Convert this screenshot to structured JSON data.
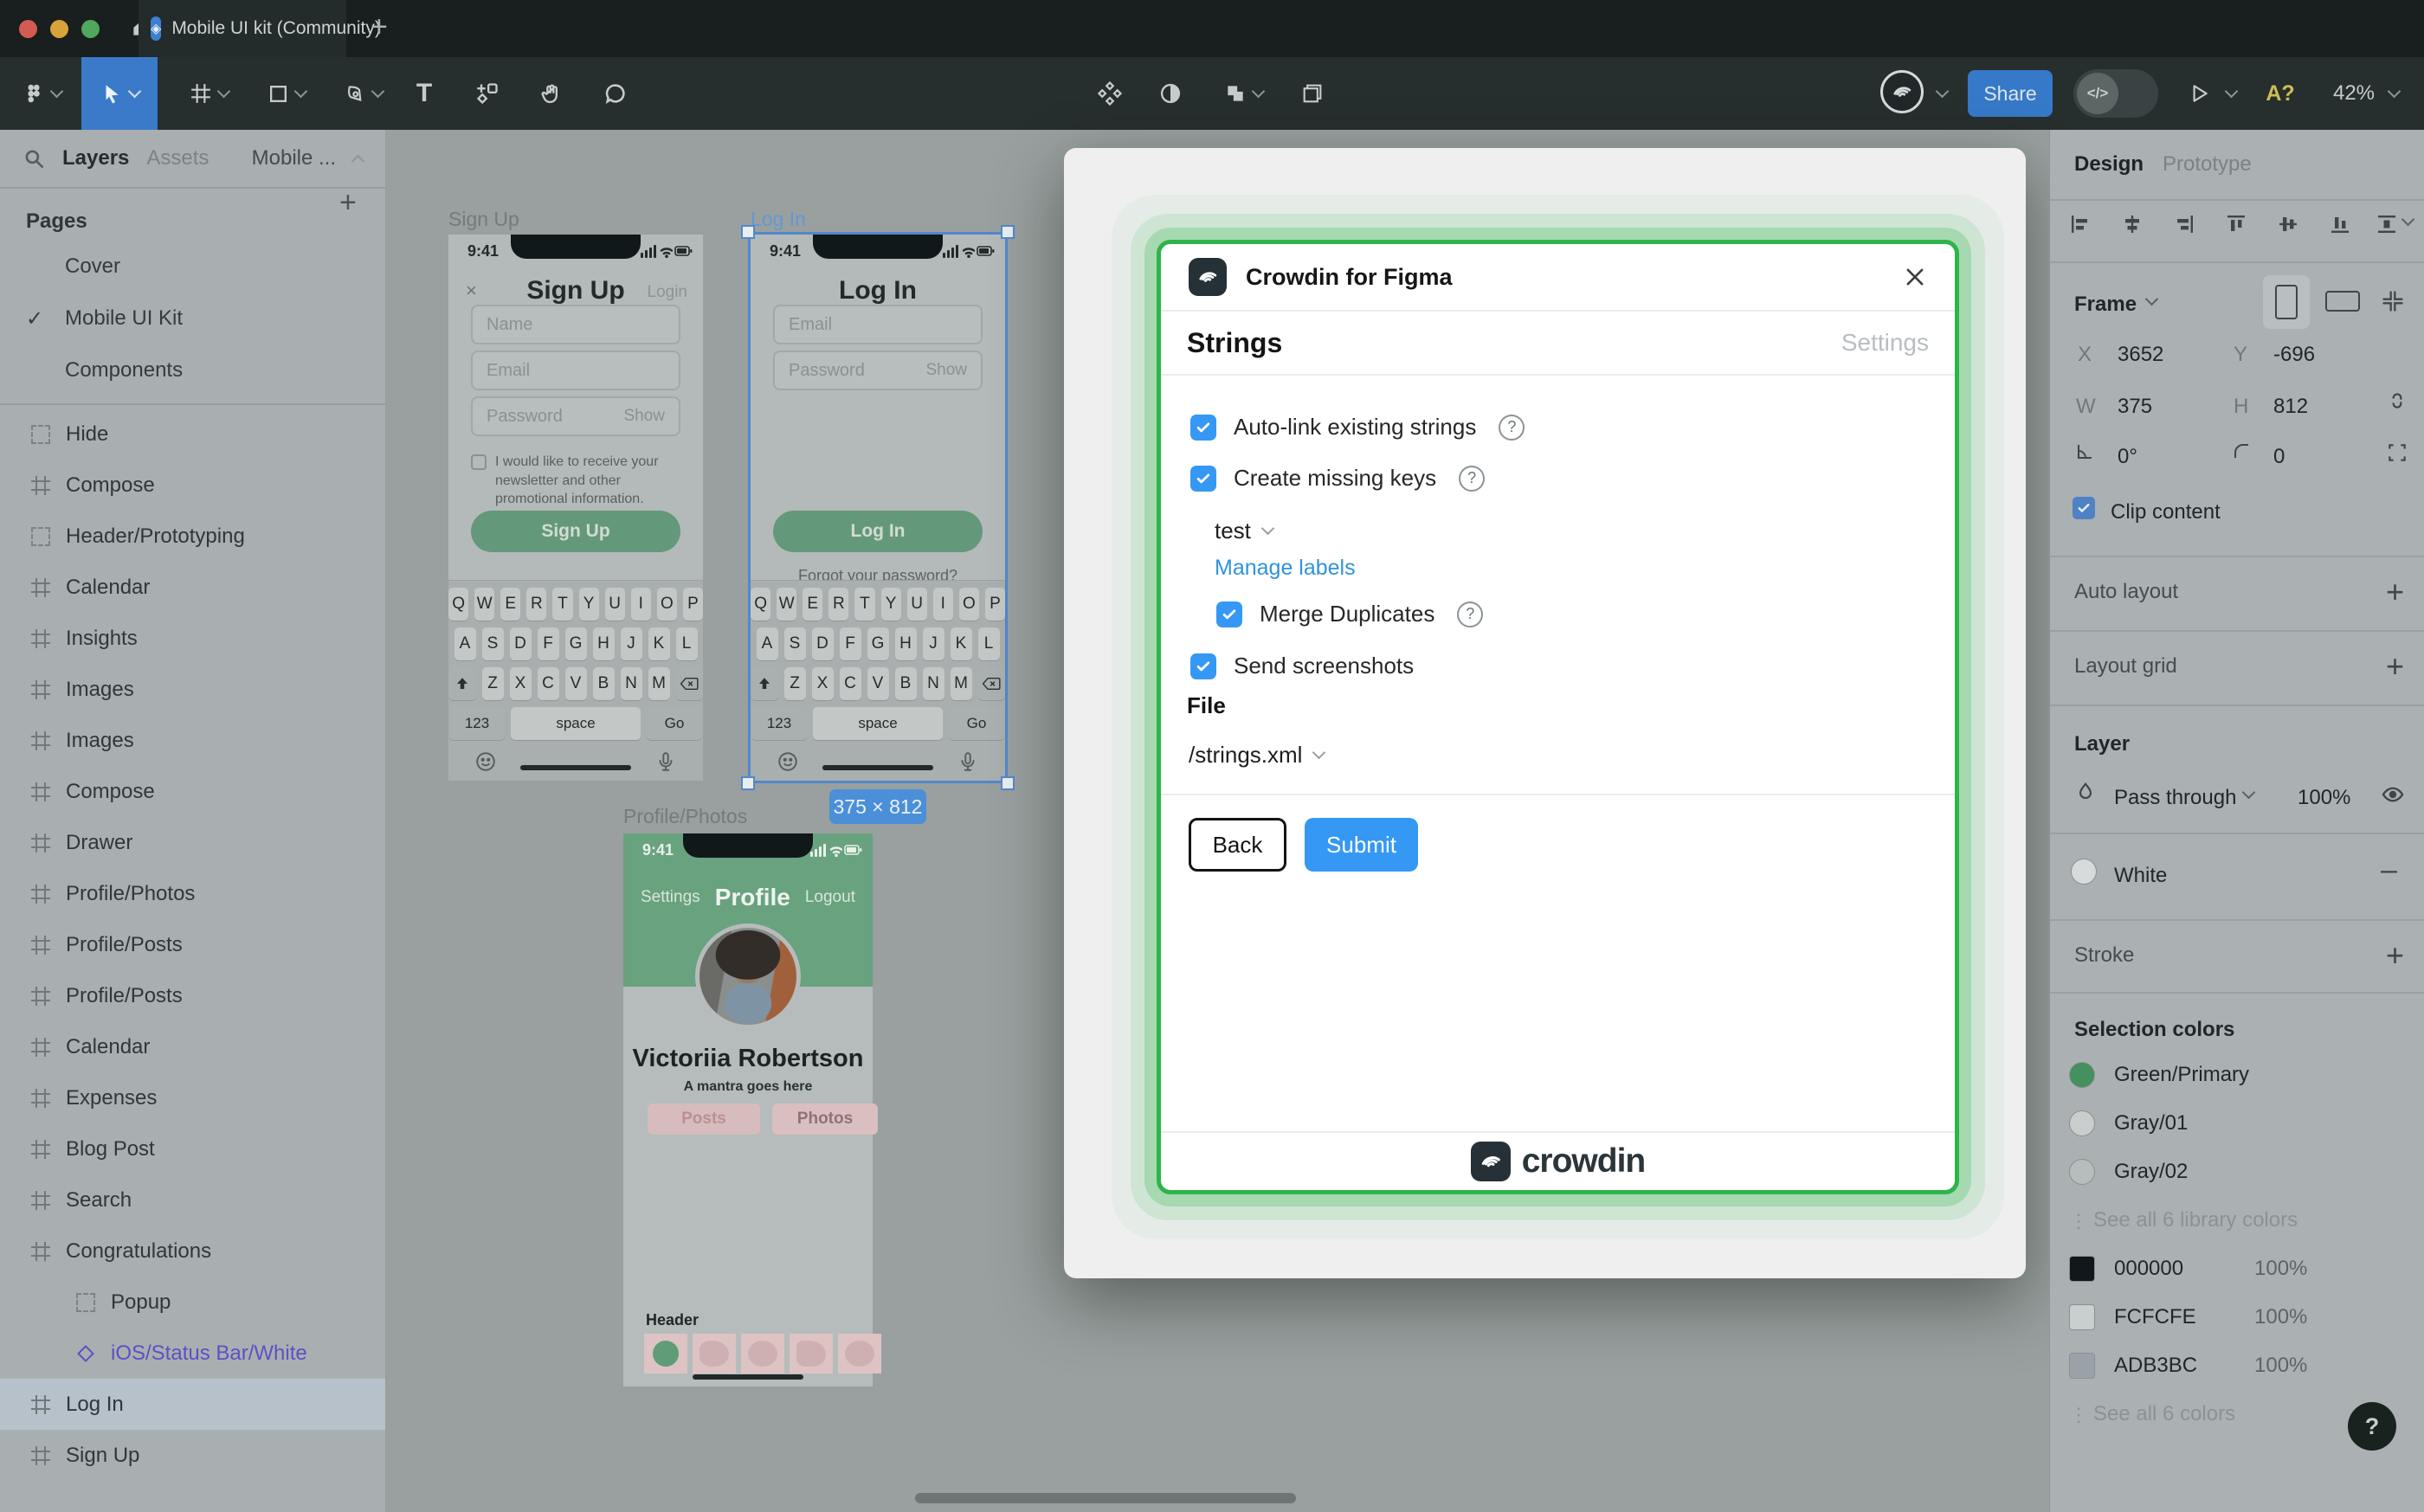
{
  "titlebar": {
    "tab_title": "Mobile UI kit (Community)"
  },
  "toolbar": {
    "share_label": "Share",
    "missing_fonts": "A?",
    "zoom_level": "42%"
  },
  "left_panel": {
    "tab_layers": "Layers",
    "tab_assets": "Assets",
    "page_menu": "Mobile ...",
    "pages_header": "Pages",
    "pages": [
      {
        "label": "Cover",
        "check": ""
      },
      {
        "label": "Mobile UI Kit",
        "check": "✓"
      },
      {
        "label": "Components",
        "check": ""
      }
    ],
    "layers": [
      {
        "label": "Hide",
        "icon": "dashed",
        "cls": ""
      },
      {
        "label": "Compose",
        "icon": "frame",
        "cls": ""
      },
      {
        "label": "Header/Prototyping",
        "icon": "dashed",
        "cls": ""
      },
      {
        "label": "Calendar",
        "icon": "frame",
        "cls": ""
      },
      {
        "label": "Insights",
        "icon": "frame",
        "cls": ""
      },
      {
        "label": "Images",
        "icon": "frame",
        "cls": ""
      },
      {
        "label": "Images",
        "icon": "frame",
        "cls": ""
      },
      {
        "label": "Compose",
        "icon": "frame",
        "cls": ""
      },
      {
        "label": "Drawer",
        "icon": "frame",
        "cls": ""
      },
      {
        "label": "Profile/Photos",
        "icon": "frame",
        "cls": ""
      },
      {
        "label": "Profile/Posts",
        "icon": "frame",
        "cls": ""
      },
      {
        "label": "Profile/Posts",
        "icon": "frame",
        "cls": ""
      },
      {
        "label": "Calendar",
        "icon": "frame",
        "cls": ""
      },
      {
        "label": "Expenses",
        "icon": "frame",
        "cls": ""
      },
      {
        "label": "Blog Post",
        "icon": "frame",
        "cls": ""
      },
      {
        "label": "Search",
        "icon": "frame",
        "cls": ""
      },
      {
        "label": "Congratulations",
        "icon": "frame",
        "cls": ""
      },
      {
        "label": "Popup",
        "icon": "dashed",
        "cls": "nested"
      },
      {
        "label": "iOS/Status Bar/White",
        "icon": "component",
        "cls": "nested purple"
      },
      {
        "label": "Log In",
        "icon": "frame",
        "cls": "selected"
      },
      {
        "label": "Sign Up",
        "icon": "frame",
        "cls": ""
      }
    ]
  },
  "canvas": {
    "signup": {
      "frame_label": "Sign Up",
      "time": "9:41",
      "close": "×",
      "title": "Sign Up",
      "top_link": "Login",
      "ph_name": "Name",
      "ph_email": "Email",
      "ph_password": "Password",
      "show": "Show",
      "newsletter": "I would like to receive your newsletter and other promotional information.",
      "cta": "Sign Up"
    },
    "login": {
      "frame_label": "Log In",
      "time": "9:41",
      "title": "Log In",
      "ph_email": "Email",
      "ph_password": "Password",
      "show": "Show",
      "cta": "Log In",
      "forgot": "Forgot your password?"
    },
    "profile": {
      "frame_label": "Profile/Photos",
      "time": "9:41",
      "nav_left": "Settings",
      "nav_title": "Profile",
      "nav_right": "Logout",
      "name": "Victoriia Robertson",
      "mantra": "A mantra goes here",
      "btn_posts": "Posts",
      "btn_photos": "Photos",
      "header_label": "Header"
    },
    "size_badge": "375 × 812",
    "keyboard": {
      "row1": [
        "Q",
        "W",
        "E",
        "R",
        "T",
        "Y",
        "U",
        "I",
        "O",
        "P"
      ],
      "row2": [
        "A",
        "S",
        "D",
        "F",
        "G",
        "H",
        "J",
        "K",
        "L"
      ],
      "row3": [
        "Z",
        "X",
        "C",
        "V",
        "B",
        "N",
        "M"
      ],
      "num": "123",
      "space": "space",
      "go": "Go"
    }
  },
  "plugin": {
    "window_title": "Crowdin for Figma",
    "tab_strings": "Strings",
    "tab_settings": "Settings",
    "autolink": "Auto-link existing strings",
    "create_keys": "Create missing keys",
    "branch": "test",
    "manage_labels": "Manage labels",
    "merge_duplicates": "Merge Duplicates",
    "send_screenshots": "Send screenshots",
    "file_label": "File",
    "file_value": "/strings.xml",
    "back": "Back",
    "submit": "Submit",
    "brand": "crowdin",
    "question": "?"
  },
  "right_panel": {
    "tab_design": "Design",
    "tab_prototype": "Prototype",
    "frame": "Frame",
    "x_label": "X",
    "x_value": "3652",
    "y_label": "Y",
    "y_value": "-696",
    "w_label": "W",
    "w_value": "375",
    "h_label": "H",
    "h_value": "812",
    "rotation": "0°",
    "corner_radius": "0",
    "clip_content": "Clip content",
    "auto_layout": "Auto layout",
    "layout_grid": "Layout grid",
    "layer": "Layer",
    "blend_mode": "Pass through",
    "opacity": "100%",
    "fill_name": "White",
    "stroke": "Stroke",
    "selection_colors": "Selection colors",
    "library_colors": [
      {
        "name": "Green/Primary",
        "color": "#44905f"
      },
      {
        "name": "Gray/01",
        "color": "#c9cecd"
      },
      {
        "name": "Gray/02",
        "color": "#b7bdbd"
      }
    ],
    "see_library": "See all 6 library colors",
    "hex_colors": [
      {
        "name": "000000",
        "pct": "100%",
        "color": "#11181b"
      },
      {
        "name": "FCFCFE",
        "pct": "100%",
        "color": "#c9cecf"
      },
      {
        "name": "ADB3BC",
        "pct": "100%",
        "color": "#9aa1a8"
      }
    ],
    "see_all": "See all 6 colors",
    "help": "?"
  },
  "colors": {
    "accent_blue": "#3b7ac9",
    "crowdin_green": "#2eb449",
    "checkbox_blue": "#3598f4",
    "selection_blue": "#5288cc"
  }
}
